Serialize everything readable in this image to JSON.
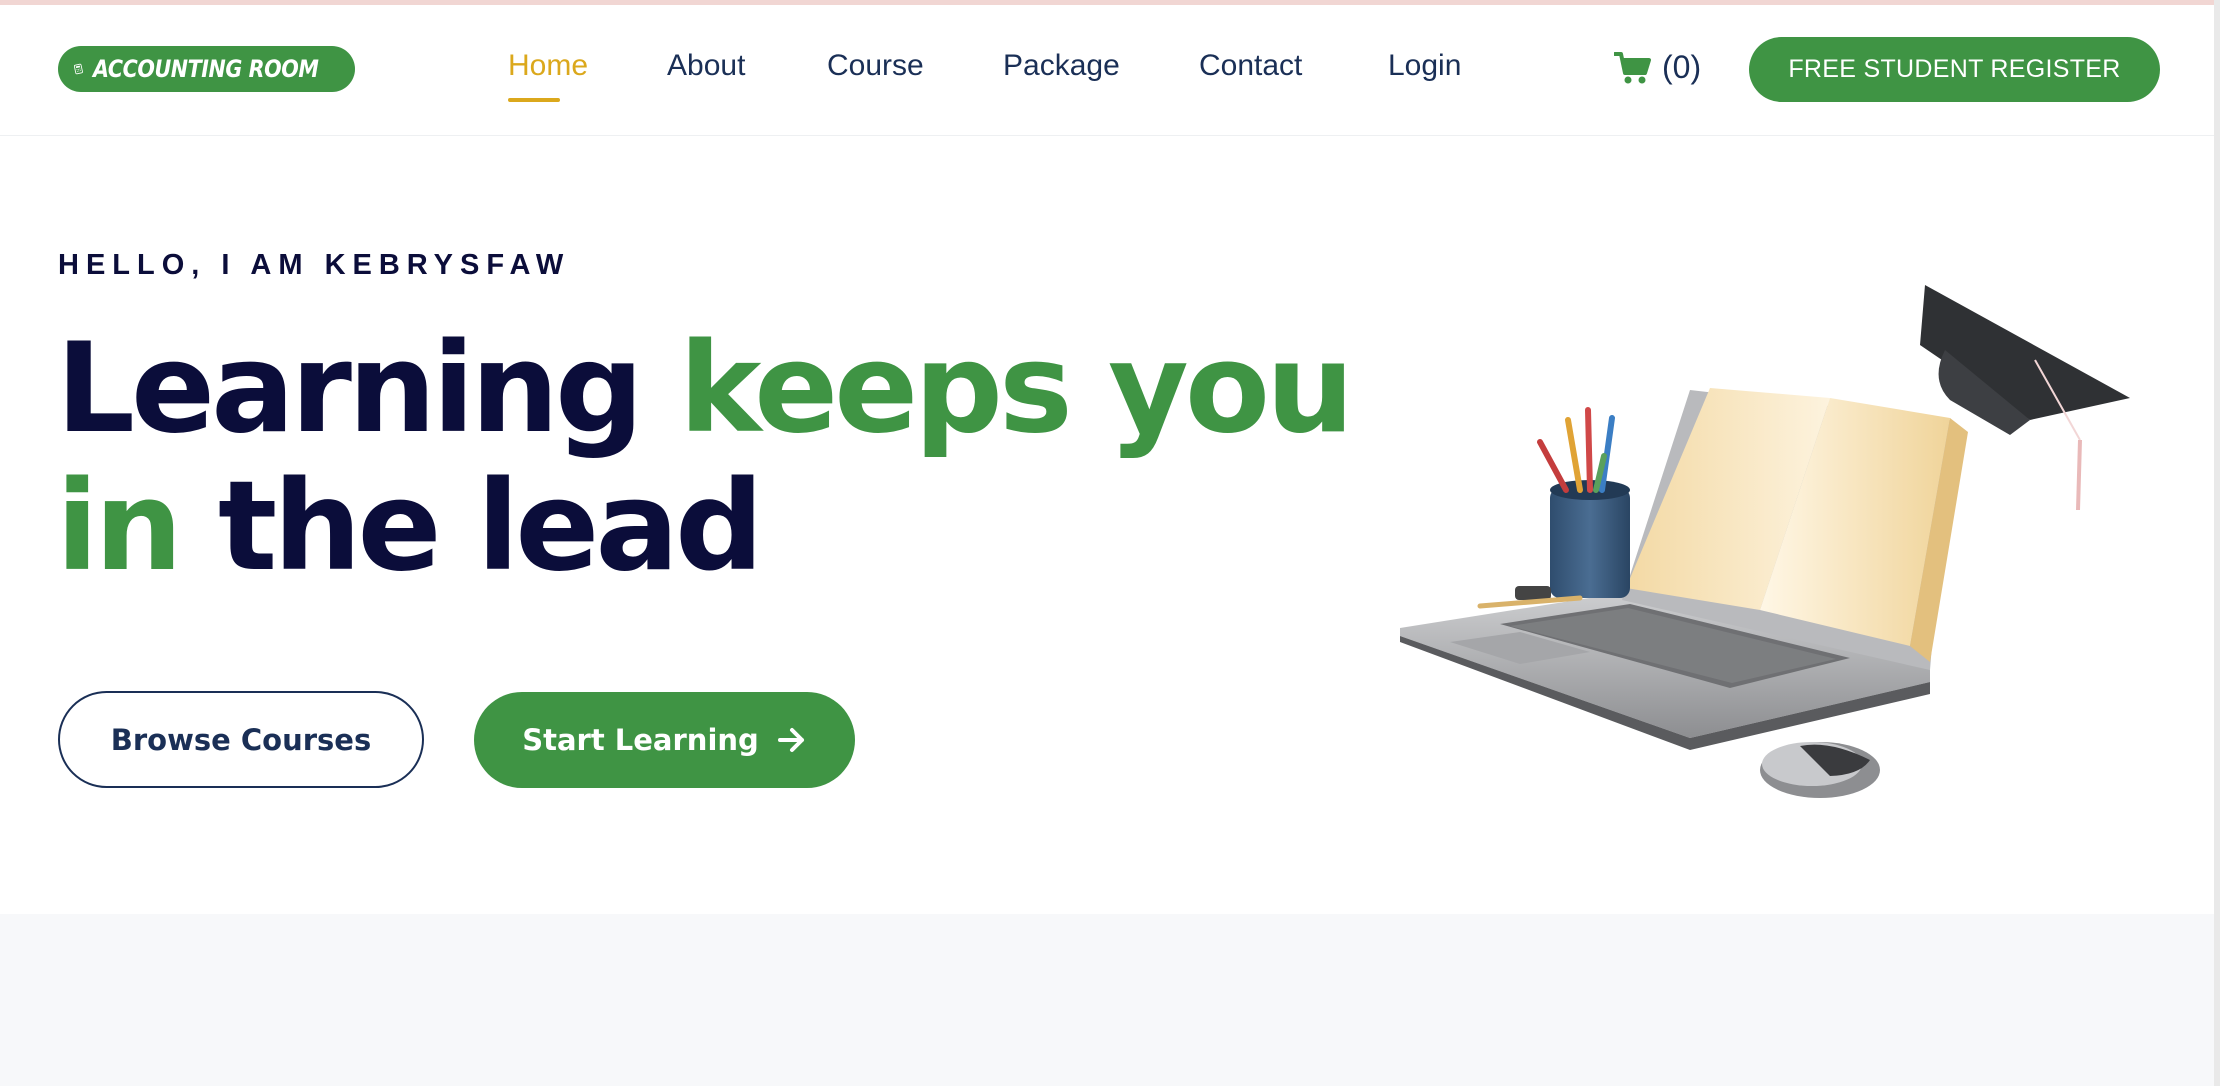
{
  "brand": {
    "name": "ACCOUNTING ROOM",
    "color": "#3f9444"
  },
  "nav": {
    "items": [
      {
        "label": "Home",
        "active": true
      },
      {
        "label": "About",
        "active": false
      },
      {
        "label": "Course",
        "active": false
      },
      {
        "label": "Package",
        "active": false
      },
      {
        "label": "Contact",
        "active": false
      },
      {
        "label": "Login",
        "active": false
      }
    ],
    "active_color": "#dba81c"
  },
  "cart": {
    "icon": "cart-icon",
    "count": "(0)"
  },
  "register_button": "FREE STUDENT REGISTER",
  "hero": {
    "kicker": "HELLO, I AM KEBRYSFAW",
    "headline": {
      "line1_dark": "Learning",
      "line1_green": "keeps you",
      "line2_green": "in",
      "line2_dark": "the lead"
    },
    "browse_button": "Browse Courses",
    "start_button": "Start Learning",
    "start_icon": "arrow-right-icon",
    "illustration": "laptop-book-graduation-cap-illustration"
  },
  "colors": {
    "dark_text": "#0b0d3a",
    "nav_text": "#1a2f56",
    "green": "#3f9444"
  }
}
